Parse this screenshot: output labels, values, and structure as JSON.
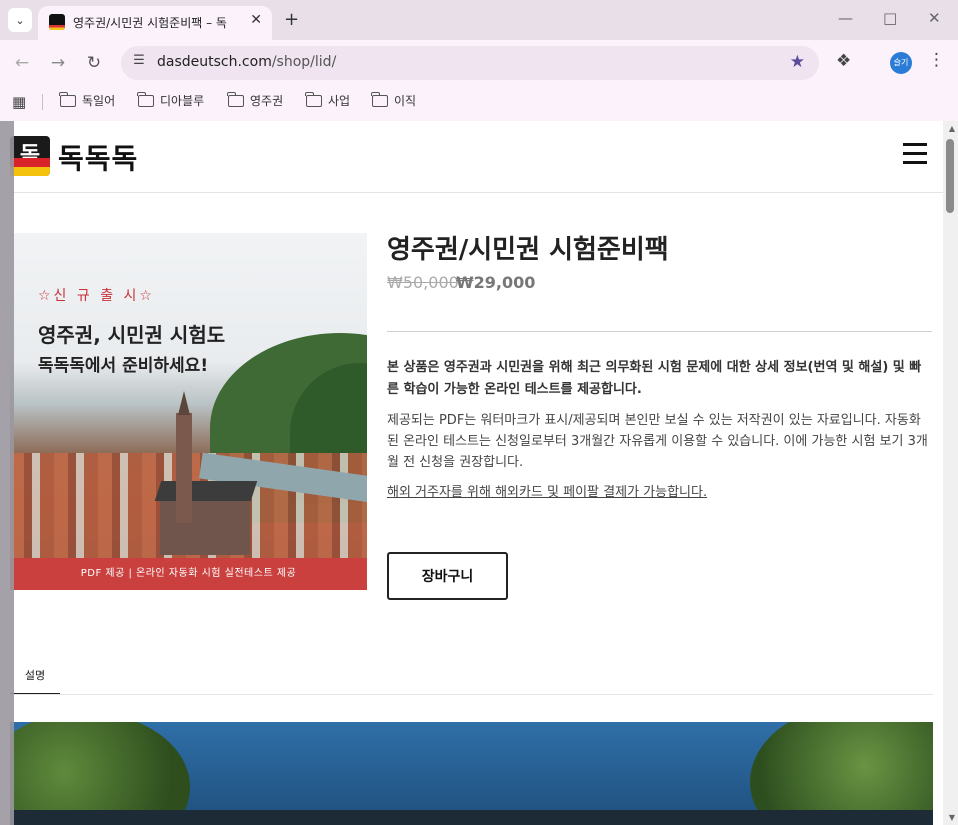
{
  "browser": {
    "tab_title": "영주권/시민권 시험준비팩 – 독",
    "tab_close": "✕",
    "new_tab": "+",
    "url_host": "dasdeutsch.com",
    "url_path": "/shop/lid/",
    "profile_initials": "슬기",
    "bookmarks": [
      "독일어",
      "디아블루",
      "영주권",
      "사업",
      "이직"
    ]
  },
  "site": {
    "logo_glyph": "독",
    "logo_text": "독독독"
  },
  "product": {
    "title": "영주권/시민권 시험준비팩",
    "price_old": "₩50,000",
    "price_new": "₩29,000",
    "desc_bold": "본 상품은 영주권과 시민권을 위해 최근 의무화된 시험 문제에 대한 상세 정보(번역 및 해설) 및 빠른 학습이 가능한 온라인 테스트를 제공합니다.",
    "desc": "제공되는 PDF는 워터마크가 표시/제공되며 본인만 보실 수 있는 저작권이 있는 자료입니다. 자동화된 온라인 테스트는 신청일로부터 3개월간 자유롭게 이용할 수 있습니다. 이에 가능한 시험 보기 3개월 전 신청을 권장합니다.",
    "desc_link": "해외 거주자를 위해 해외카드 및 페이팔 결제가 가능합니다.",
    "cart_button": "장바구니",
    "image": {
      "promo_new": "☆신 규 출 시☆",
      "promo_line1": "영주권, 시민권 시험도",
      "promo_line2": "독독독에서 준비하세요!",
      "promo_bar": "PDF 제공 | 온라인 자동화 시험 실전테스트 제공"
    }
  },
  "tabs": {
    "description": "설명"
  },
  "colors": {
    "promo_red": "#c9403f",
    "star_purple": "#5a4a9c",
    "profile_blue": "#2a7cd6"
  }
}
